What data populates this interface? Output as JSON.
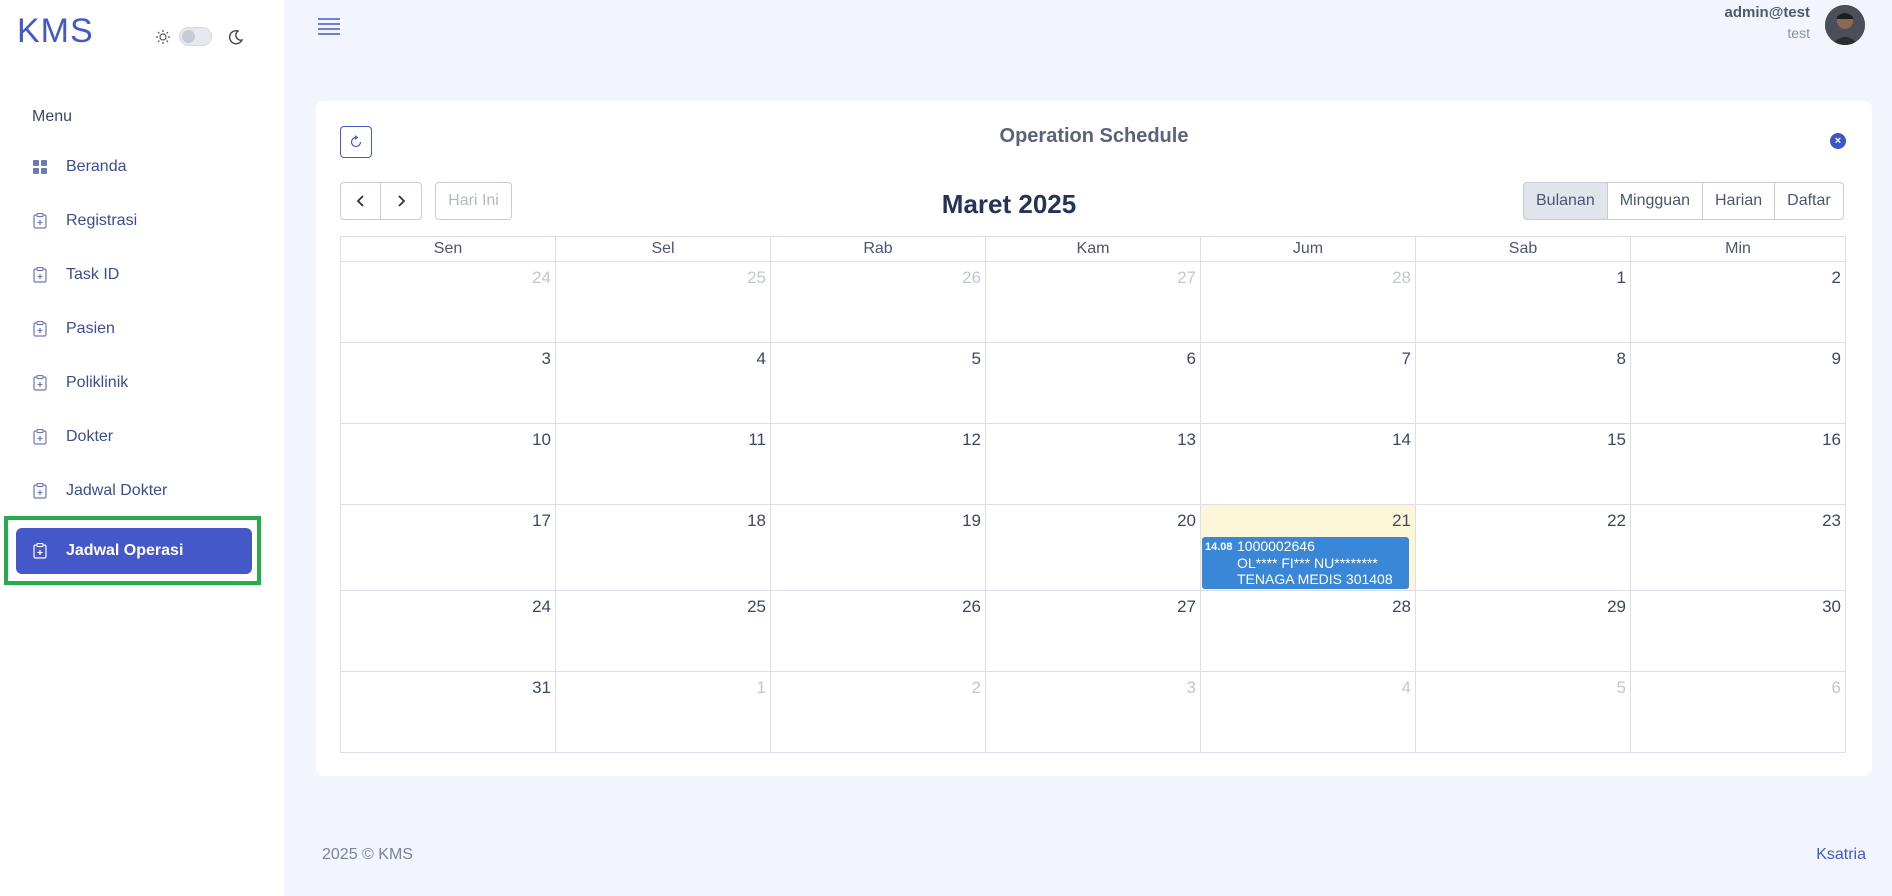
{
  "app": {
    "logo": "KMS"
  },
  "sidebar": {
    "menu_title": "Menu",
    "items": [
      {
        "label": "Beranda",
        "icon": "grid-icon"
      },
      {
        "label": "Registrasi",
        "icon": "clipboard-icon"
      },
      {
        "label": "Task ID",
        "icon": "clipboard-icon"
      },
      {
        "label": "Pasien",
        "icon": "clipboard-icon"
      },
      {
        "label": "Poliklinik",
        "icon": "clipboard-icon"
      },
      {
        "label": "Dokter",
        "icon": "clipboard-icon"
      },
      {
        "label": "Jadwal Dokter",
        "icon": "clipboard-icon"
      },
      {
        "label": "Jadwal Operasi",
        "icon": "clipboard-icon",
        "active": true
      }
    ]
  },
  "user": {
    "name": "admin@test",
    "role": "test"
  },
  "card": {
    "title": "Operation Schedule"
  },
  "calendar": {
    "today_label": "Hari Ini",
    "month_title": "Maret 2025",
    "views": [
      "Bulanan",
      "Mingguan",
      "Harian",
      "Daftar"
    ],
    "active_view": "Bulanan",
    "weekdays": [
      "Sen",
      "Sel",
      "Rab",
      "Kam",
      "Jum",
      "Sab",
      "Min"
    ],
    "weeks": [
      [
        {
          "d": "24",
          "o": true
        },
        {
          "d": "25",
          "o": true
        },
        {
          "d": "26",
          "o": true
        },
        {
          "d": "27",
          "o": true
        },
        {
          "d": "28",
          "o": true
        },
        {
          "d": "1"
        },
        {
          "d": "2"
        }
      ],
      [
        {
          "d": "3"
        },
        {
          "d": "4"
        },
        {
          "d": "5"
        },
        {
          "d": "6"
        },
        {
          "d": "7"
        },
        {
          "d": "8"
        },
        {
          "d": "9"
        }
      ],
      [
        {
          "d": "10"
        },
        {
          "d": "11"
        },
        {
          "d": "12"
        },
        {
          "d": "13"
        },
        {
          "d": "14"
        },
        {
          "d": "15"
        },
        {
          "d": "16"
        }
      ],
      [
        {
          "d": "17"
        },
        {
          "d": "18"
        },
        {
          "d": "19"
        },
        {
          "d": "20"
        },
        {
          "d": "21",
          "today": true
        },
        {
          "d": "22"
        },
        {
          "d": "23"
        }
      ],
      [
        {
          "d": "24"
        },
        {
          "d": "25"
        },
        {
          "d": "26"
        },
        {
          "d": "27"
        },
        {
          "d": "28"
        },
        {
          "d": "29"
        },
        {
          "d": "30"
        }
      ],
      [
        {
          "d": "31"
        },
        {
          "d": "1",
          "o": true
        },
        {
          "d": "2",
          "o": true
        },
        {
          "d": "3",
          "o": true
        },
        {
          "d": "4",
          "o": true
        },
        {
          "d": "5",
          "o": true
        },
        {
          "d": "6",
          "o": true
        }
      ]
    ],
    "event": {
      "time": "14.08",
      "line1": "1000002646",
      "line2": "OL**** FI*** NU********",
      "line3": "TENAGA MEDIS 301408"
    }
  },
  "footer": {
    "copyright": "2025 © KMS",
    "credit": "Ksatria"
  },
  "colors": {
    "primary": "#4558c9",
    "event": "#3a87d8",
    "today_bg": "#fdf6d8",
    "highlight": "#25ad4a"
  }
}
